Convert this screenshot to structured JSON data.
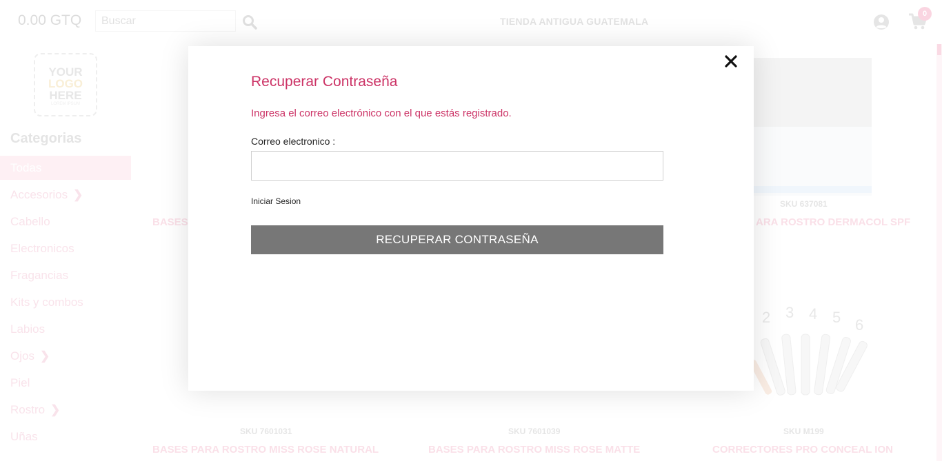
{
  "header": {
    "balance": "0.00 GTQ",
    "search_placeholder": "Buscar",
    "store_name": "TIENDA ANTIGUA GUATEMALA",
    "cart_count": "0"
  },
  "sidebar": {
    "logo": {
      "line1": "YOUR",
      "line2": "LOGO",
      "line3": "HERE",
      "line4": "LOREM IPSUM"
    },
    "categories_title": "Categorias",
    "items": [
      {
        "label": "Todas",
        "active": true,
        "has_children": false
      },
      {
        "label": "Accesorios",
        "active": false,
        "has_children": true
      },
      {
        "label": "Cabello",
        "active": false,
        "has_children": false
      },
      {
        "label": "Electronicos",
        "active": false,
        "has_children": false
      },
      {
        "label": "Fragancias",
        "active": false,
        "has_children": false
      },
      {
        "label": "Kits y combos",
        "active": false,
        "has_children": false
      },
      {
        "label": "Labios",
        "active": false,
        "has_children": false
      },
      {
        "label": "Ojos",
        "active": false,
        "has_children": true
      },
      {
        "label": "Piel",
        "active": false,
        "has_children": false
      },
      {
        "label": "Rostro",
        "active": false,
        "has_children": true
      },
      {
        "label": "Uñas",
        "active": false,
        "has_children": false
      }
    ]
  },
  "products": {
    "row1": {
      "left_name_partial": "BASES",
      "right_sku": "SKU 637081",
      "right_name_partial": "ARA ROSTRO DERMACOL SPF"
    },
    "row2": [
      {
        "sku": "SKU 7601031",
        "name": "BASES PARA ROSTRO MISS ROSE NATURAL"
      },
      {
        "sku": "SKU 7601039",
        "name": "BASES PARA ROSTRO MISS ROSE MATTE"
      },
      {
        "sku": "SKU M199",
        "name": "CORRECTORES PRO CONCEAL ION"
      }
    ],
    "corrector_shades": [
      "2",
      "3",
      "4",
      "5",
      "6"
    ]
  },
  "modal": {
    "title": "Recuperar Contraseña",
    "description": "Ingresa el correo electrónico con el que estás registrado.",
    "email_label": "Correo electronico :",
    "email_value": "",
    "login_link": "Iniciar Sesion",
    "submit_label": "RECUPERAR CONTRASEÑA"
  },
  "colors": {
    "accent": "#cc3366",
    "button": "#777777",
    "badge": "#f7bfd1"
  }
}
